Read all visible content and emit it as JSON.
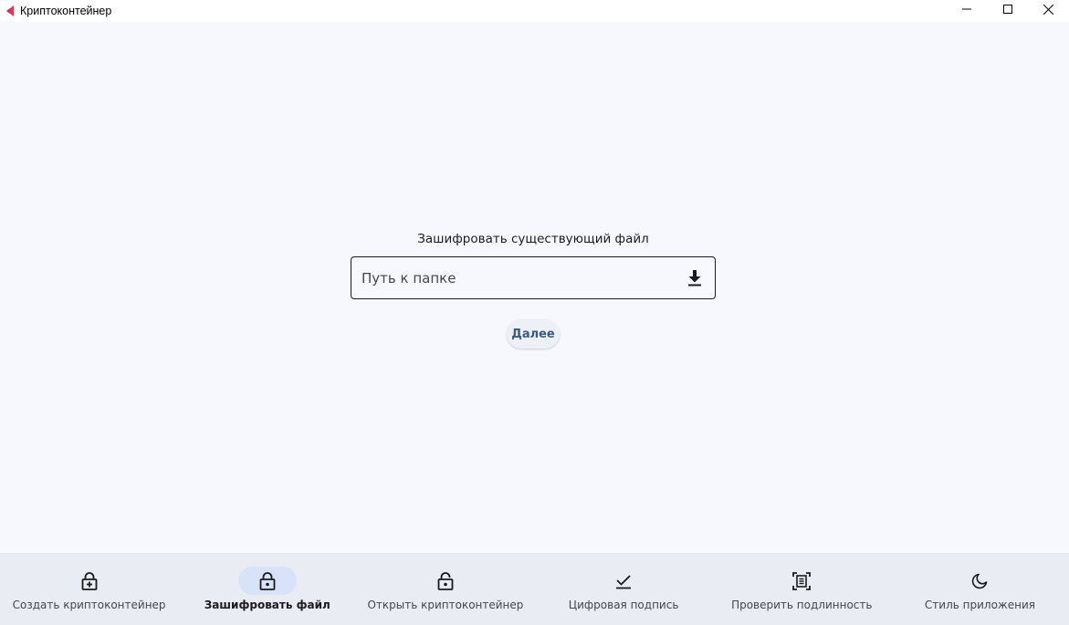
{
  "window": {
    "title": "Криптоконтейнер",
    "logo_icon": "app-logo-icon",
    "controls": [
      "minimize-icon",
      "maximize-icon",
      "close-icon"
    ]
  },
  "main": {
    "section_label": "Зашифровать существующий файл",
    "path_field": {
      "placeholder": "Путь к папке",
      "value": "",
      "action_icon": "download-icon"
    },
    "next_button": "Далее"
  },
  "bottom_nav": {
    "active_index": 1,
    "items": [
      {
        "label": "Создать криптоконтейнер",
        "icon": "lock-plus-icon"
      },
      {
        "label": "Зашифровать файл",
        "icon": "lock-icon"
      },
      {
        "label": "Открыть криптоконтейнер",
        "icon": "lock-open-icon"
      },
      {
        "label": "Цифровая подпись",
        "icon": "check-icon"
      },
      {
        "label": "Проверить подлинность",
        "icon": "document-scan-icon"
      },
      {
        "label": "Стиль приложения",
        "icon": "moon-icon"
      }
    ]
  },
  "colors": {
    "background": "#f7f8fd",
    "nav_background": "#eaecf3",
    "active_pill": "#d8e2f8",
    "button_text": "#3d5a87",
    "logo_red": "#e8374f",
    "logo_pink": "#c62a7a"
  }
}
